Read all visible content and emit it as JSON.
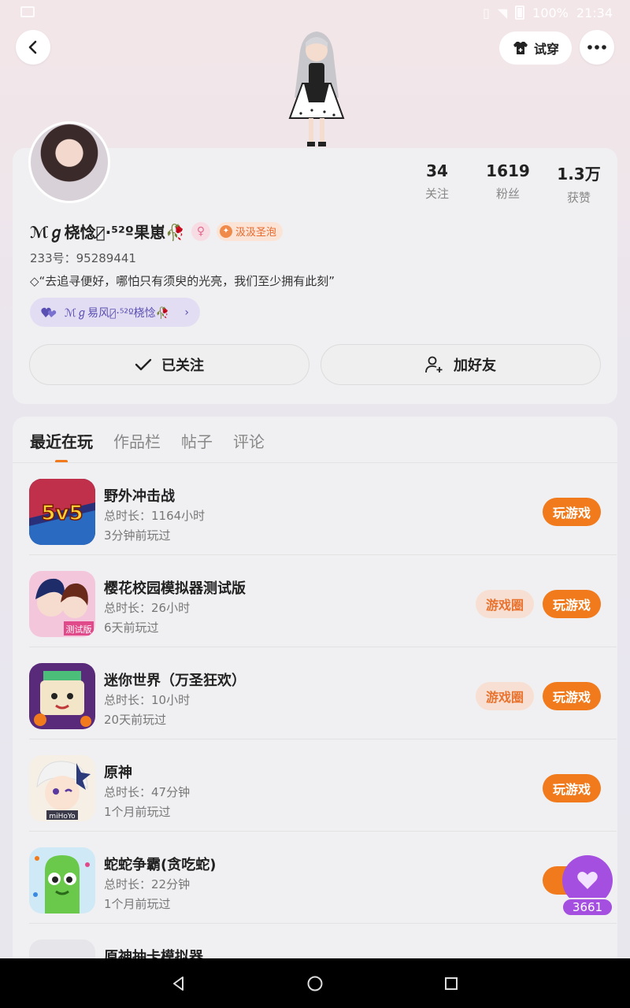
{
  "status_bar": {
    "battery": "100%",
    "time": "21:34"
  },
  "header": {
    "tryon_label": "试穿"
  },
  "profile": {
    "username": "ℳℊ桡惗ℊ̷·⁵²º果崽🥀",
    "medal_label": "汲汲圣泡",
    "uid_text": "233号：95289441",
    "bio": "◇“去追寻便好，哪怕只有须臾的光亮，我们至少拥有此刻”",
    "club_label": "ℳℊ易风ℊ̷·⁵²º桡惗🥀",
    "stats": [
      {
        "value": "34",
        "label": "关注"
      },
      {
        "value": "1619",
        "label": "粉丝"
      },
      {
        "value": "1.3万",
        "label": "获赞"
      }
    ],
    "follow_label": "已关注",
    "add_friend_label": "加好友"
  },
  "tabs": [
    {
      "label": "最近在玩",
      "active": true
    },
    {
      "label": "作品栏",
      "active": false
    },
    {
      "label": "帖子",
      "active": false
    },
    {
      "label": "评论",
      "active": false
    }
  ],
  "games": [
    {
      "title": "野外冲击战",
      "duration": "总时长：1164小时",
      "last_played": "3分钟前玩过",
      "circle_label": "",
      "play_label": "玩游戏",
      "icon": "game-icon-5v5"
    },
    {
      "title": "樱花校园模拟器测试版",
      "duration": "总时长：26小时",
      "last_played": "6天前玩过",
      "circle_label": "游戏圈",
      "play_label": "玩游戏",
      "icon": "game-icon-sakura"
    },
    {
      "title": "迷你世界（万圣狂欢）",
      "duration": "总时长：10小时",
      "last_played": "20天前玩过",
      "circle_label": "游戏圈",
      "play_label": "玩游戏",
      "icon": "game-icon-mini"
    },
    {
      "title": "原神",
      "duration": "总时长：47分钟",
      "last_played": "1个月前玩过",
      "circle_label": "",
      "play_label": "玩游戏",
      "icon": "game-icon-genshin"
    },
    {
      "title": "蛇蛇争霸(贪吃蛇)",
      "duration": "总时长：22分钟",
      "last_played": "1个月前玩过",
      "circle_label": "",
      "play_label": "玩",
      "icon": "game-icon-snake"
    },
    {
      "title": "原神抽卡模拟器",
      "duration": "",
      "last_played": "",
      "circle_label": "",
      "play_label": "",
      "icon": "game-icon-gacha"
    }
  ],
  "like_float": {
    "count": "3661"
  },
  "colors": {
    "accent": "#f07a1c",
    "like": "#a44fe0",
    "club": "#5a4fb2"
  }
}
